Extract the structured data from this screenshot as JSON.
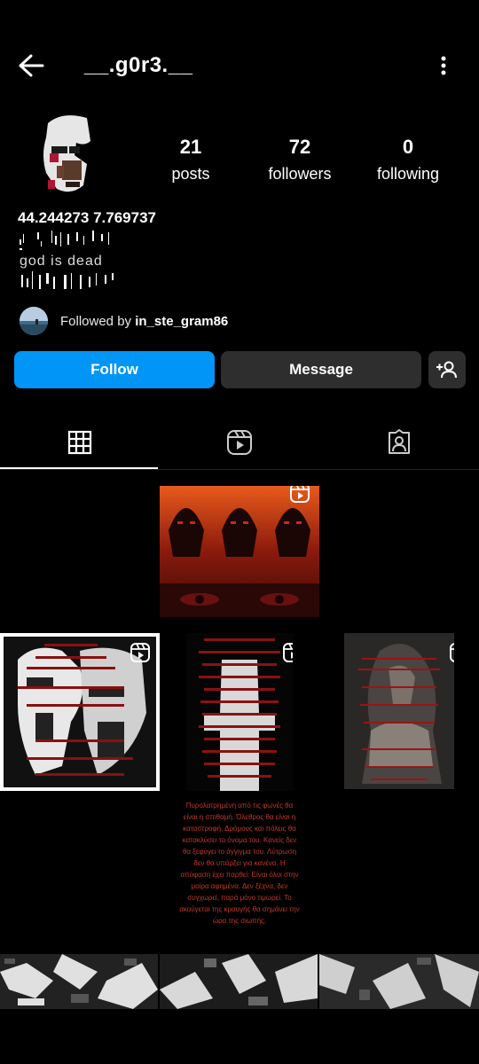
{
  "header": {
    "username": "__.g0r3.__",
    "back_icon": "arrow-left-icon",
    "menu_icon": "more-vertical-icon"
  },
  "stats": {
    "posts": {
      "count": "21",
      "label": "posts"
    },
    "followers": {
      "count": "72",
      "label": "followers"
    },
    "following": {
      "count": "0",
      "label": "following"
    }
  },
  "bio": {
    "name": "44.244273 7.769737",
    "text": "god is dead"
  },
  "followed_by": {
    "prefix": "Followed by ",
    "user": "in_ste_gram86"
  },
  "actions": {
    "follow_label": "Follow",
    "message_label": "Message",
    "add_user_icon": "person-add-icon"
  },
  "tabs": [
    {
      "name": "grid",
      "icon": "grid-icon",
      "active": true
    },
    {
      "name": "reels",
      "icon": "reels-icon",
      "active": false
    },
    {
      "name": "tagged",
      "icon": "tagged-user-icon",
      "active": false
    }
  ],
  "colors": {
    "accent": "#0095f6",
    "button_dark": "#2e2e2e",
    "background": "#000000",
    "post_text_red": "#c0392b"
  },
  "posts": {
    "p5_text": "Πυρολατρημένη από τις φωνές θα είναι η σπιθαμή. Όλεθρος θα είναι η καταστροφή. Δρόμους και πόλεις θα κατακλύσει το όνομα του. Κανείς δεν θα ξεφύγει το άγγιγμα του. Λύτρωση δεν θα υπάρξει για κανένα. Η απόφαση έχει παρθεί. Είναι όλοι στην μοίρα αφημένα. Δεν ξέχνα, δεν συγχωρεί, παρά μόνο τιμωρεί. Το ακούγεται της κραυγής θα σημάνει την ώρα της σιωπής."
  }
}
